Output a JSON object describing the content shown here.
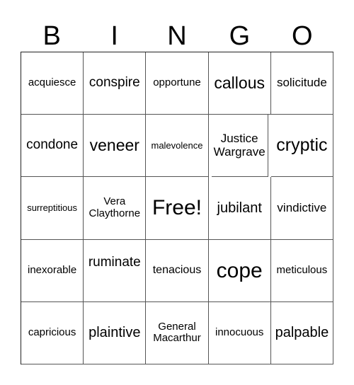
{
  "header": {
    "letters": [
      "B",
      "I",
      "N",
      "G",
      "O"
    ]
  },
  "grid": {
    "rows": [
      [
        "acquiesce",
        "conspire",
        "opportune",
        "callous",
        "solicitude"
      ],
      [
        "condone",
        "veneer",
        "malevolence",
        "Justice Wargrave",
        "cryptic"
      ],
      [
        "surreptitious",
        "Vera Claythorne",
        "Free!",
        "jubilant",
        "vindictive"
      ],
      [
        "inexorable",
        "ruminate",
        "tenacious",
        "cope",
        "meticulous"
      ],
      [
        "capricious",
        "plaintive",
        "General Macarthur",
        "innocuous",
        "palpable"
      ]
    ]
  }
}
